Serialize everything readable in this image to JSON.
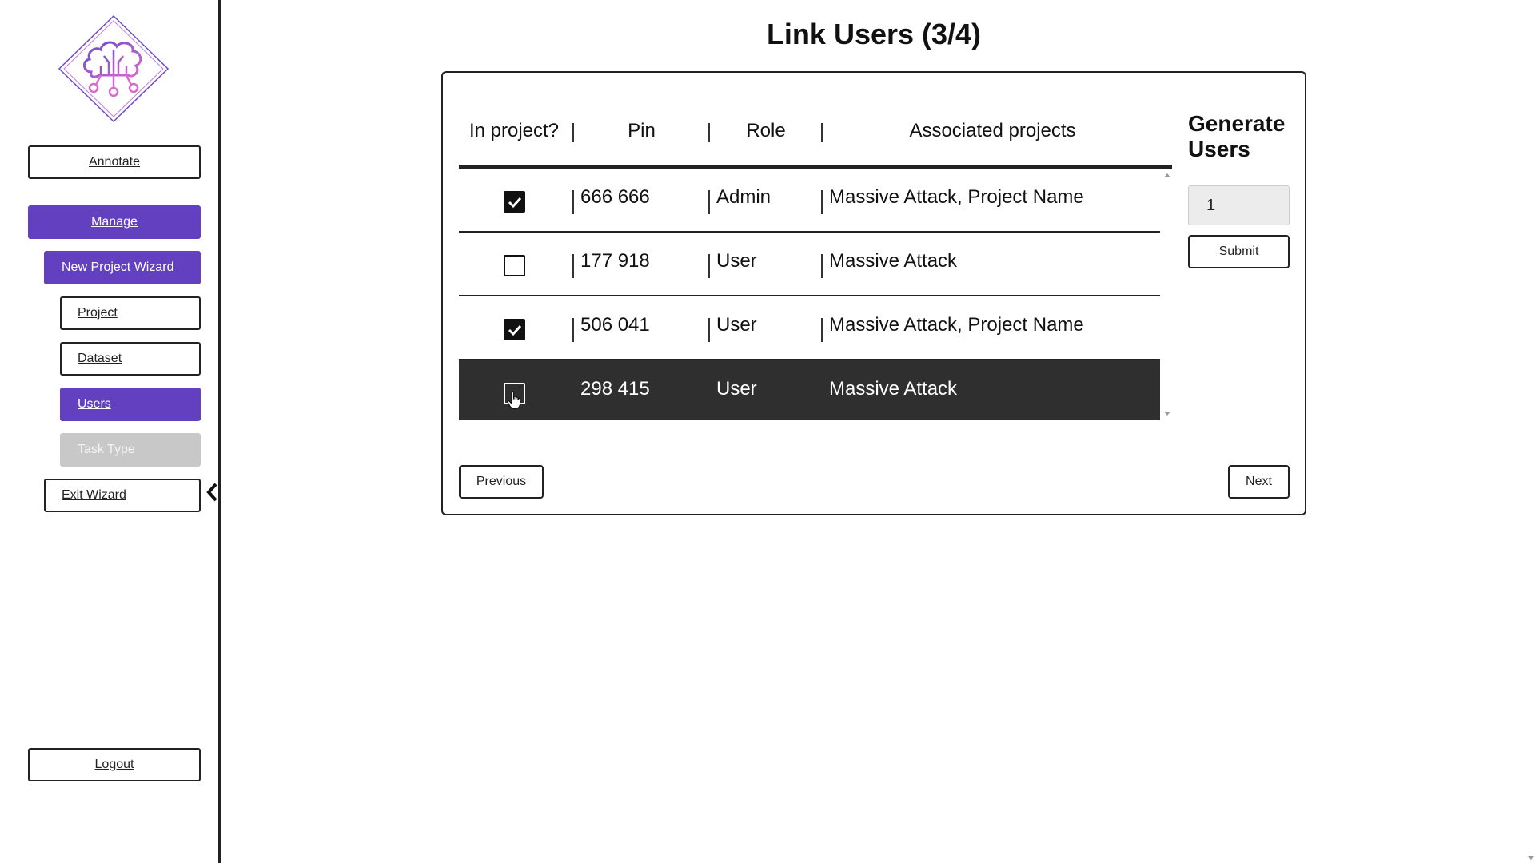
{
  "sidebar": {
    "annotate_label": "Annotate",
    "manage_label": "Manage",
    "new_project_wizard_label": "New Project Wizard",
    "project_label": "Project",
    "dataset_label": "Dataset",
    "users_label": "Users",
    "task_type_label": "Task Type",
    "exit_wizard_label": "Exit Wizard",
    "logout_label": "Logout",
    "accent_color": "#6240c0"
  },
  "main": {
    "title": "Link Users (3/4)",
    "table": {
      "headers": {
        "in_project": "In project?",
        "pin": "Pin",
        "role": "Role",
        "projects": "Associated projects"
      },
      "rows": [
        {
          "checked": true,
          "pin": "666 666",
          "role": "Admin",
          "projects": "Massive Attack, Project Name"
        },
        {
          "checked": false,
          "pin": "177 918",
          "role": "User",
          "projects": "Massive Attack"
        },
        {
          "checked": true,
          "pin": "506 041",
          "role": "User",
          "projects": "Massive Attack, Project Name"
        },
        {
          "checked": false,
          "pin": "298 415",
          "role": "User",
          "projects": "Massive Attack",
          "selected": true
        }
      ]
    },
    "generate": {
      "title": "Generate Users",
      "count_value": "1",
      "submit_label": "Submit"
    },
    "previous_label": "Previous",
    "next_label": "Next"
  }
}
